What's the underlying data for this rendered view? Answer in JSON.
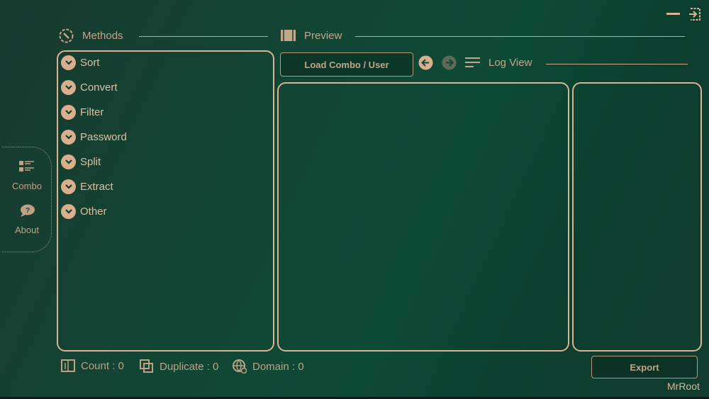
{
  "window": {
    "minimize_icon": "minus-icon",
    "exit_icon": "exit-icon"
  },
  "sidebar": {
    "items": [
      {
        "label": "Combo",
        "icon": "list-icon"
      },
      {
        "label": "About",
        "icon": "help-bubble-icon"
      }
    ]
  },
  "methods": {
    "title": "Methods",
    "items": [
      "Sort",
      "Convert",
      "Filter",
      "Password",
      "Split",
      "Extract",
      "Other"
    ]
  },
  "preview": {
    "title": "Preview",
    "load_button": "Load Combo / User",
    "log_view": "Log View"
  },
  "stats": {
    "count": "Count : 0",
    "duplicate": "Duplicate : 0",
    "domain": "Domain : 0"
  },
  "export_button": "Export",
  "footer": {
    "author": "MrRoot"
  },
  "colors": {
    "accent": "#d7b492",
    "bg": "#134534"
  }
}
